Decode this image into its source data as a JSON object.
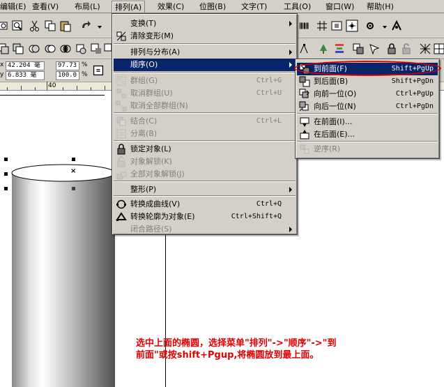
{
  "menubar": {
    "items": [
      {
        "label": "编辑(E)"
      },
      {
        "label": "查看(V)"
      },
      {
        "label": "布局(L)"
      },
      {
        "label": "排列(A)"
      },
      {
        "label": "效果(C)"
      },
      {
        "label": "位图(B)"
      },
      {
        "label": "文字(T)"
      },
      {
        "label": "工具(O)"
      },
      {
        "label": "窗口(W)"
      },
      {
        "label": "帮助(H)"
      }
    ]
  },
  "propbar": {
    "x_value": "42.204 毫",
    "y_value": "6.833 毫",
    "w_value": "97.73",
    "h_value": "100.0",
    "percent": "%"
  },
  "ruler": {
    "label": "40"
  },
  "arrange_menu": {
    "items": [
      {
        "label": "变换(T)",
        "shortcut": "",
        "submenu": true,
        "disabled": false,
        "icon": "none"
      },
      {
        "label": "清除变形(M)",
        "shortcut": "",
        "submenu": false,
        "disabled": false,
        "icon": "clear-transform-icon"
      },
      {
        "label": "排列与分布(A)",
        "shortcut": "",
        "submenu": true,
        "disabled": false,
        "icon": "none"
      },
      {
        "label": "顺序(O)",
        "shortcut": "",
        "submenu": true,
        "disabled": false,
        "icon": "none"
      },
      {
        "label": "群组(G)",
        "shortcut": "Ctrl+G",
        "submenu": false,
        "disabled": true,
        "icon": "group-icon"
      },
      {
        "label": "取消群组(U)",
        "shortcut": "Ctrl+U",
        "submenu": false,
        "disabled": true,
        "icon": "ungroup-icon"
      },
      {
        "label": "取消全部群组(N)",
        "shortcut": "",
        "submenu": false,
        "disabled": true,
        "icon": "ungroup-all-icon"
      },
      {
        "label": "结合(C)",
        "shortcut": "Ctrl+L",
        "submenu": false,
        "disabled": true,
        "icon": "combine-icon"
      },
      {
        "label": "分离(B)",
        "shortcut": "",
        "submenu": false,
        "disabled": true,
        "icon": "break-apart-icon"
      },
      {
        "label": "锁定对象(L)",
        "shortcut": "",
        "submenu": false,
        "disabled": false,
        "icon": "lock-icon"
      },
      {
        "label": "对象解锁(K)",
        "shortcut": "",
        "submenu": false,
        "disabled": true,
        "icon": "unlock-icon"
      },
      {
        "label": "全部对象解锁(J)",
        "shortcut": "",
        "submenu": false,
        "disabled": true,
        "icon": "unlock-all-icon"
      },
      {
        "label": "整形(P)",
        "shortcut": "",
        "submenu": true,
        "disabled": false,
        "icon": "none"
      },
      {
        "label": "转换成曲线(V)",
        "shortcut": "Ctrl+Q",
        "submenu": false,
        "disabled": false,
        "icon": "convert-curves-icon"
      },
      {
        "label": "转换轮廓为对象(E)",
        "shortcut": "Ctrl+Shift+Q",
        "submenu": false,
        "disabled": false,
        "icon": "outline-to-object-icon"
      },
      {
        "label": "闭合路径(S)",
        "shortcut": "",
        "submenu": true,
        "disabled": true,
        "icon": "none"
      }
    ]
  },
  "order_submenu": {
    "items": [
      {
        "label": "到前面(F)",
        "shortcut": "Shift+PgUp",
        "disabled": false
      },
      {
        "label": "到后面(B)",
        "shortcut": "Shift+PgDn",
        "disabled": false
      },
      {
        "label": "向前一位(O)",
        "shortcut": "Ctrl+PgUp",
        "disabled": false
      },
      {
        "label": "向后一位(N)",
        "shortcut": "Ctrl+PgDn",
        "disabled": false
      },
      {
        "label": "在前面(I)...",
        "shortcut": "",
        "disabled": false
      },
      {
        "label": "在后面(E)...",
        "shortcut": "",
        "disabled": false
      },
      {
        "label": "逆序(R)",
        "shortcut": "",
        "disabled": true
      }
    ]
  },
  "annotation": {
    "text": "选中上面的椭圆，选择菜单\"排列\"->\"顺序\"->\"到前面\"或按shift+Pgup,将椭圆放到最上面。"
  },
  "colors": {
    "highlight": "#0a246a",
    "annotation": "#e00000",
    "chrome": "#d4d0c8"
  }
}
